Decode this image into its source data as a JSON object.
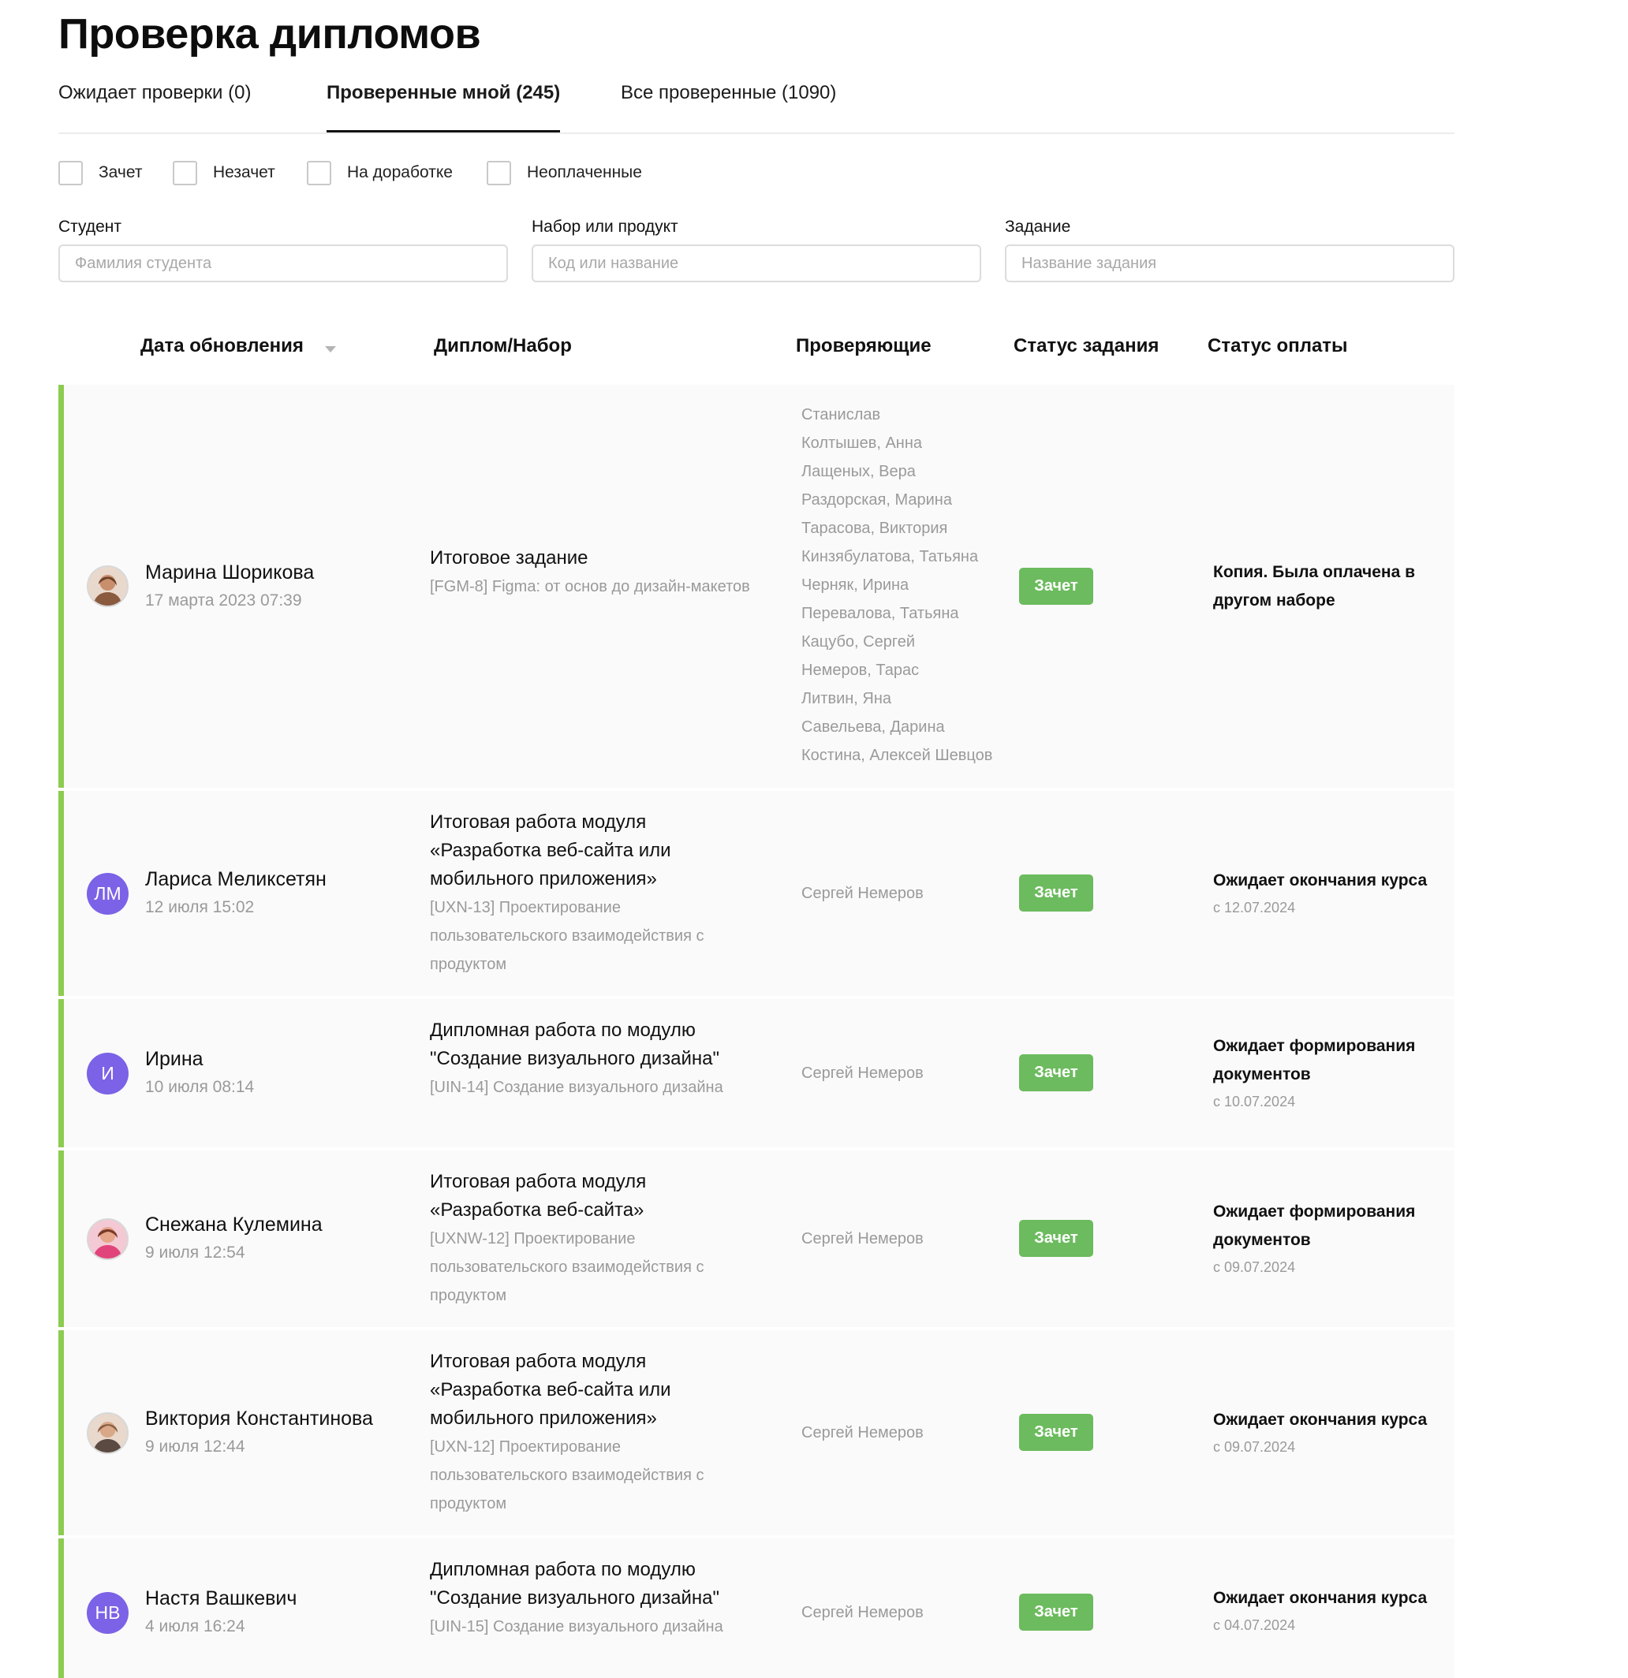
{
  "page": {
    "title": "Проверка дипломов"
  },
  "tabs": [
    {
      "label": "Ожидает проверки (0)",
      "active": false
    },
    {
      "label": "Проверенные мной (245)",
      "active": true
    },
    {
      "label": "Все проверенные (1090)",
      "active": false
    }
  ],
  "filters": [
    {
      "label": "Зачет",
      "checked": false
    },
    {
      "label": "Незачет",
      "checked": false
    },
    {
      "label": "На доработке",
      "checked": false
    },
    {
      "label": "Неоплаченные",
      "checked": false
    }
  ],
  "fields": {
    "student": {
      "label": "Студент",
      "placeholder": "Фамилия студента",
      "value": ""
    },
    "set": {
      "label": "Набор или продукт",
      "placeholder": "Код или название",
      "value": ""
    },
    "task": {
      "label": "Задание",
      "placeholder": "Название задания",
      "value": ""
    }
  },
  "table": {
    "columns": [
      "Дата обновления",
      "Диплом/Набор",
      "Проверяющие",
      "Статус задания",
      "Статус оплаты"
    ],
    "sort_icon": "caret-down-icon",
    "accent_color": "#8ccc50",
    "badge_color": "#6cbb5e",
    "rows": [
      {
        "avatar": {
          "type": "photo",
          "text": ""
        },
        "name": "Марина Шорикова",
        "date": "17 марта 2023 07:39",
        "title": "Итоговое задание",
        "set": "[FGM-8] Figma: от основ до дизайн-макетов",
        "reviewers": [
          "Станислав",
          "Колтышев, Анна",
          "Лащеных, Вера",
          "Раздорская, Марина",
          "Тарасова, Виктория",
          "Кинзябулатова, Татьяна",
          "Черняк, Ирина",
          "Перевалова, Татьяна",
          "Кацубо, Сергей",
          "Немеров, Тарас",
          "Литвин, Яна",
          "Савельева, Дарина",
          "Костина, Алексей Шевцов"
        ],
        "status": "Зачет",
        "payment": "Копия. Была оплачена в другом наборе",
        "payment_since": ""
      },
      {
        "avatar": {
          "type": "initials",
          "text": "ЛМ"
        },
        "name": "Лариса Меликсетян",
        "date": "12 июля 15:02",
        "title": "Итоговая работа модуля «Разработка веб-сайта или мобильного приложения»",
        "set": "[UXN-13] Проектирование пользовательского взаимодействия с продуктом",
        "reviewers": [
          "Сергей Немеров"
        ],
        "status": "Зачет",
        "payment": "Ожидает окончания курса",
        "payment_since": "с 12.07.2024"
      },
      {
        "avatar": {
          "type": "initials",
          "text": "И"
        },
        "name": "Ирина",
        "date": "10 июля 08:14",
        "title": "Дипломная работа по модулю \"Создание визуального дизайна\"",
        "set": "[UIN-14] Создание визуального дизайна",
        "reviewers": [
          "Сергей Немеров"
        ],
        "status": "Зачет",
        "payment": "Ожидает формирования документов",
        "payment_since": "с 10.07.2024"
      },
      {
        "avatar": {
          "type": "photo",
          "text": ""
        },
        "name": "Снежана Кулемина",
        "date": "9 июля 12:54",
        "title": "Итоговая работа модуля «Разработка веб-сайта»",
        "set": "[UXNW-12] Проектирование пользовательского взаимодействия с продуктом",
        "reviewers": [
          "Сергей Немеров"
        ],
        "status": "Зачет",
        "payment": "Ожидает формирования документов",
        "payment_since": "с 09.07.2024"
      },
      {
        "avatar": {
          "type": "photo",
          "text": ""
        },
        "name": "Виктория Константинова",
        "date": "9 июля 12:44",
        "title": "Итоговая работа модуля «Разработка веб-сайта или мобильного приложения»",
        "set": "[UXN-12] Проектирование пользовательского взаимодействия с продуктом",
        "reviewers": [
          "Сергей Немеров"
        ],
        "status": "Зачет",
        "payment": "Ожидает окончания курса",
        "payment_since": "с 09.07.2024"
      },
      {
        "avatar": {
          "type": "initials",
          "text": "НВ"
        },
        "name": "Настя Вашкевич",
        "date": "4 июля 16:24",
        "title": "Дипломная работа по модулю \"Создание визуального дизайна\"",
        "set": "[UIN-15] Создание визуального дизайна",
        "reviewers": [
          "Сергей Немеров"
        ],
        "status": "Зачет",
        "payment": "Ожидает окончания курса",
        "payment_since": "с 04.07.2024"
      }
    ]
  }
}
